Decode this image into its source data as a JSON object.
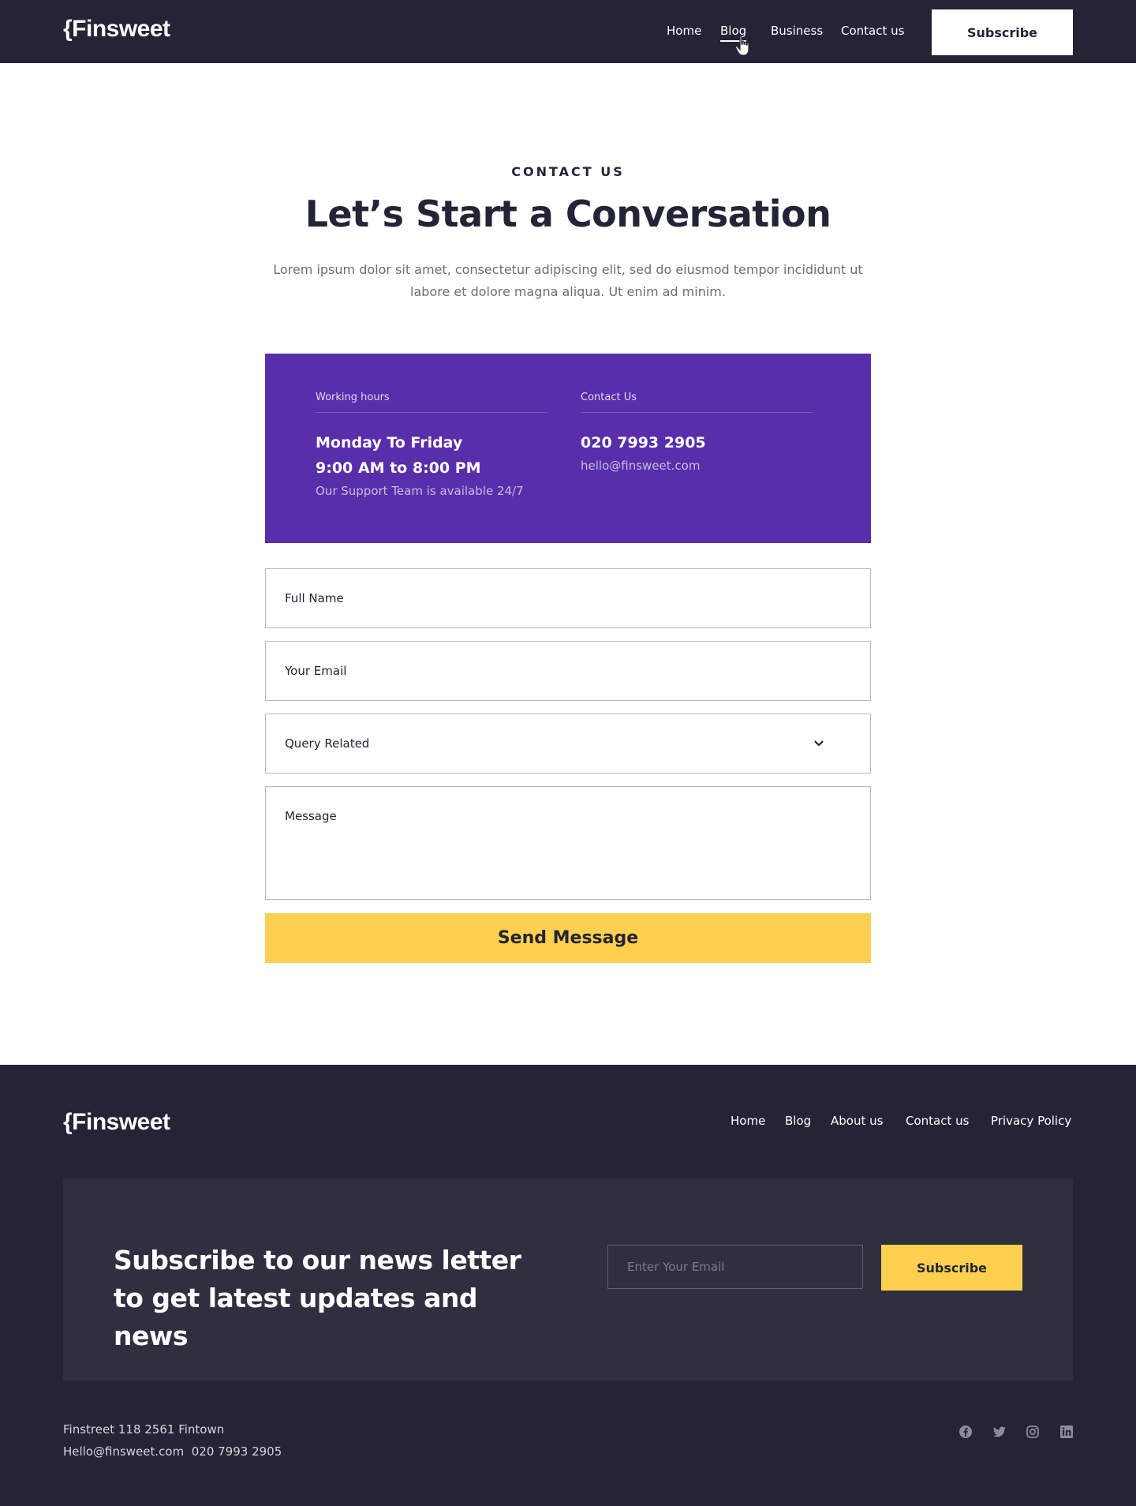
{
  "header": {
    "logo": "{Finsweet",
    "nav": [
      "Home",
      "Blog",
      "Business",
      "Contact us"
    ],
    "active_nav": "Blog",
    "subscribe_label": "Subscribe"
  },
  "hero": {
    "eyebrow": "CONTACT US",
    "title": "Let’s Start a Conversation",
    "intro": "Lorem ipsum dolor sit amet, consectetur adipiscing elit, sed do eiusmod tempor incididunt ut labore et dolore magna aliqua. Ut enim ad minim."
  },
  "info_card": {
    "working_hours_label": "Working hours",
    "days": "Monday To Friday",
    "hours": "9:00 AM to 8:00 PM",
    "support_note": "Our Support Team is available 24/7",
    "contact_label": "Contact Us",
    "phone": "020 7993 2905",
    "email": "hello@finsweet.com"
  },
  "form": {
    "full_name_placeholder": "Full Name",
    "email_placeholder": "Your Email",
    "query_selected": "Query Related",
    "message_placeholder": "Message",
    "send_label": "Send Message"
  },
  "footer": {
    "logo": "{Finsweet",
    "nav": [
      "Home",
      "Blog",
      "About us",
      "Contact us",
      "Privacy Policy"
    ],
    "newsletter_title": "Subscribe to our news letter to get latest updates and news",
    "newsletter_placeholder": "Enter Your Email",
    "newsletter_button": "Subscribe",
    "address": "Finstreet 118 2561 Fintown",
    "contact_line": "Hello@finsweet.com  020 7993 2905",
    "social_icons": [
      "facebook-icon",
      "twitter-icon",
      "instagram-icon",
      "linkedin-icon"
    ]
  },
  "colors": {
    "dark": "#232536",
    "purple": "#592eaa",
    "yellow": "#ffd050",
    "newsletter_bg": "#2e2f3f"
  }
}
